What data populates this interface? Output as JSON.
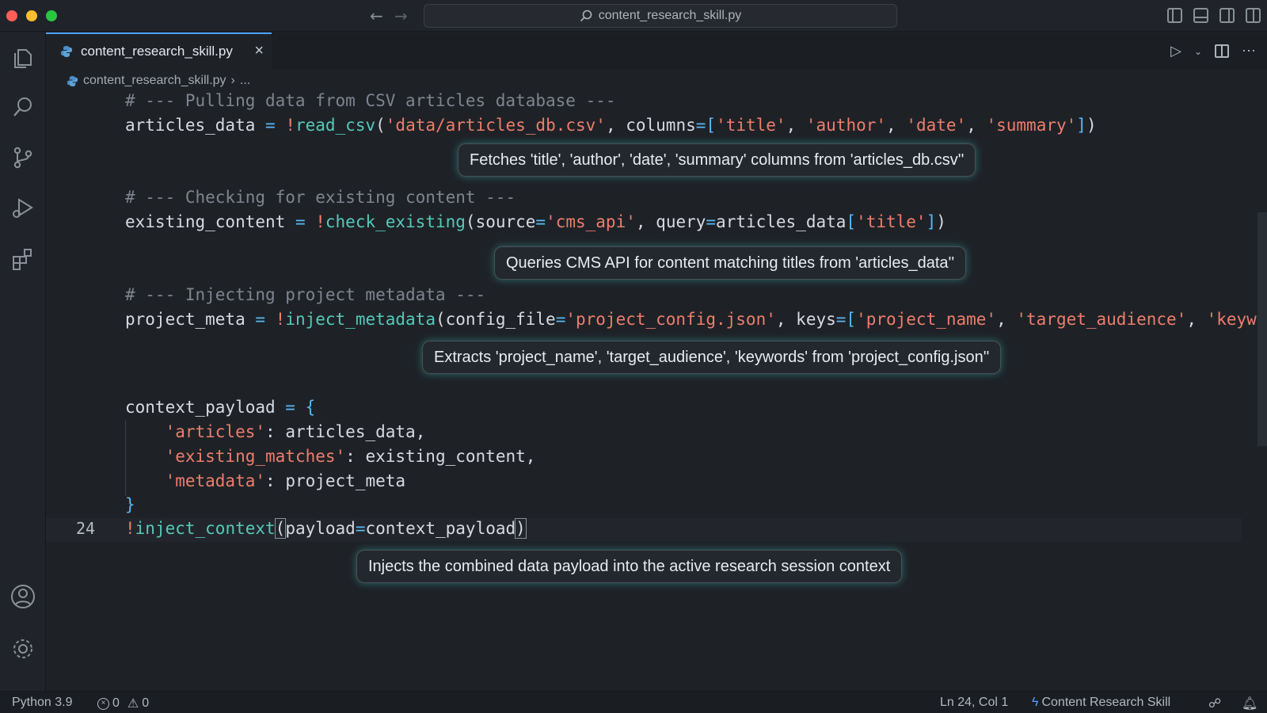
{
  "titlebar": {
    "search_text": "content_research_skill.py",
    "back_icon": "arrow-left-icon",
    "forward_icon": "arrow-right-icon"
  },
  "tab": {
    "label": "content_research_skill.py",
    "close": "×"
  },
  "breadcrumb": {
    "file": "content_research_skill.py",
    "rest": "..."
  },
  "editor": {
    "current_line_number": "24",
    "comments": {
      "c1": "# --- Pulling data from CSV articles database ---",
      "c2": "# --- Checking for existing content ---",
      "c3": "# --- Injecting project metadata ---"
    },
    "tokens": {
      "articles_data": "articles_data",
      "eq": " = ",
      "bang": "!",
      "read_csv": "read_csv",
      "csv_path": "'data/articles_db.csv'",
      "columns_kw": "columns",
      "col_title": "'title'",
      "col_author": "'author'",
      "col_date": "'date'",
      "col_summary": "'summary'",
      "existing_content": "existing_content",
      "check_existing": "check_existing",
      "source_kw": "source",
      "cms_api": "'cms_api'",
      "query_kw": "query",
      "title_key": "'title'",
      "project_meta": "project_meta",
      "inject_metadata": "inject_metadata",
      "config_file_kw": "config_file",
      "config_path": "'project_config.json'",
      "keys_kw": "keys",
      "key_project_name": "'project_name'",
      "key_target_audience": "'target_audience'",
      "key_keywords": "'keyword",
      "context_payload": "context_payload",
      "dict_articles": "'articles'",
      "dict_existing": "'existing_matches'",
      "dict_metadata": "'metadata'",
      "inject_context": "inject_context",
      "payload_kw": "payload",
      "open_brace": "{",
      "close_brace": "}"
    },
    "tooltips": {
      "t1": "Fetches 'title', 'author', 'date', 'summary' columns from 'articles_db.csv''",
      "t2": "Queries CMS API for content matching titles from 'articles_data''",
      "t3": "Extracts 'project_name', 'target_audience', 'keywords' from 'project_config.json''",
      "t4": "Injects the combined data payload into the active research session context"
    }
  },
  "statusbar": {
    "language": "Python 3.9",
    "errors": "0",
    "warnings": "0",
    "position": "Ln 24, Col 1",
    "skill": "Content Research Skill"
  },
  "colors": {
    "accent": "#4da3ff",
    "string": "#ee7d6c",
    "function": "#56c9b8",
    "comment": "#7f848e",
    "glow": "#3cc8be"
  }
}
